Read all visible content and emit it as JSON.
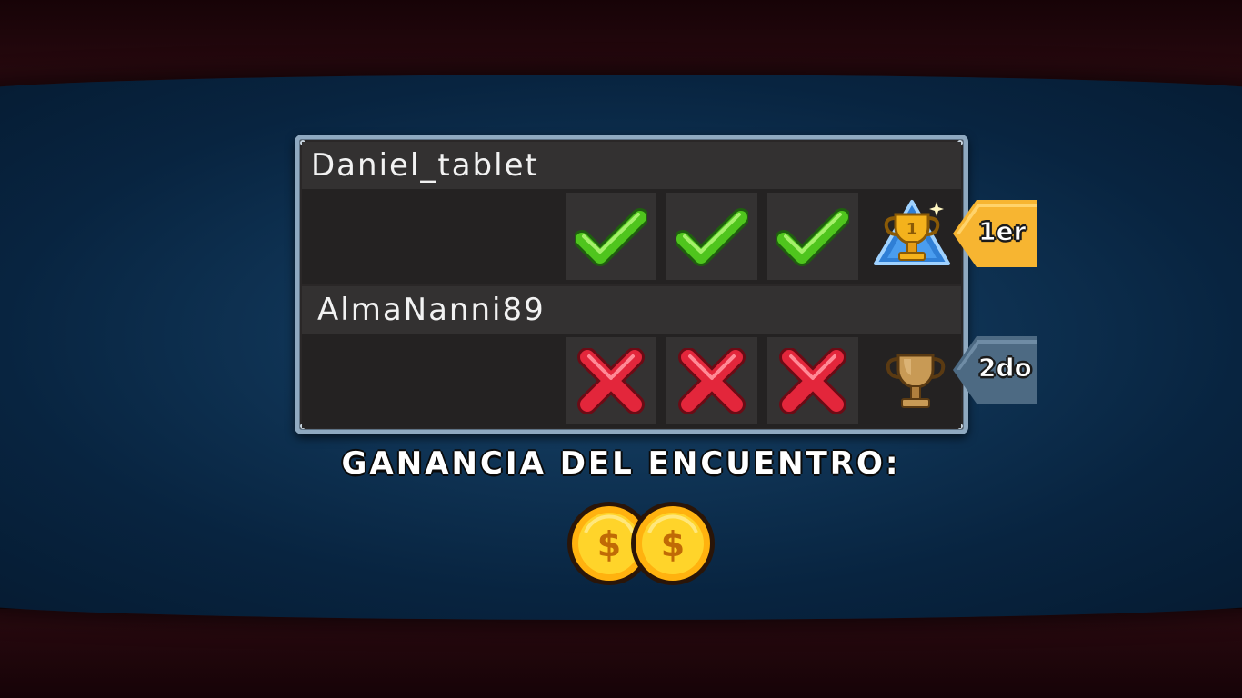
{
  "results": {
    "players": [
      {
        "name": "Daniel_tablet",
        "rounds": [
          "win",
          "win",
          "win"
        ],
        "trophy": "gold-trophy-icon",
        "rank": "1er",
        "rank_color": "#f7b531"
      },
      {
        "name": "AlmaNanni89",
        "rounds": [
          "loss",
          "loss",
          "loss"
        ],
        "trophy": "bronze-trophy-icon",
        "rank": "2do",
        "rank_color": "#4d6a83"
      }
    ]
  },
  "earnings": {
    "label": "GANANCIA DEL ENCUENTRO:",
    "coins": 2,
    "coin_icon": "dollar-coin-icon"
  },
  "colors": {
    "win": "#4fc51d",
    "loss": "#e3263b",
    "panel_border": "#8fa9c0",
    "coin": "#ffc41c"
  }
}
